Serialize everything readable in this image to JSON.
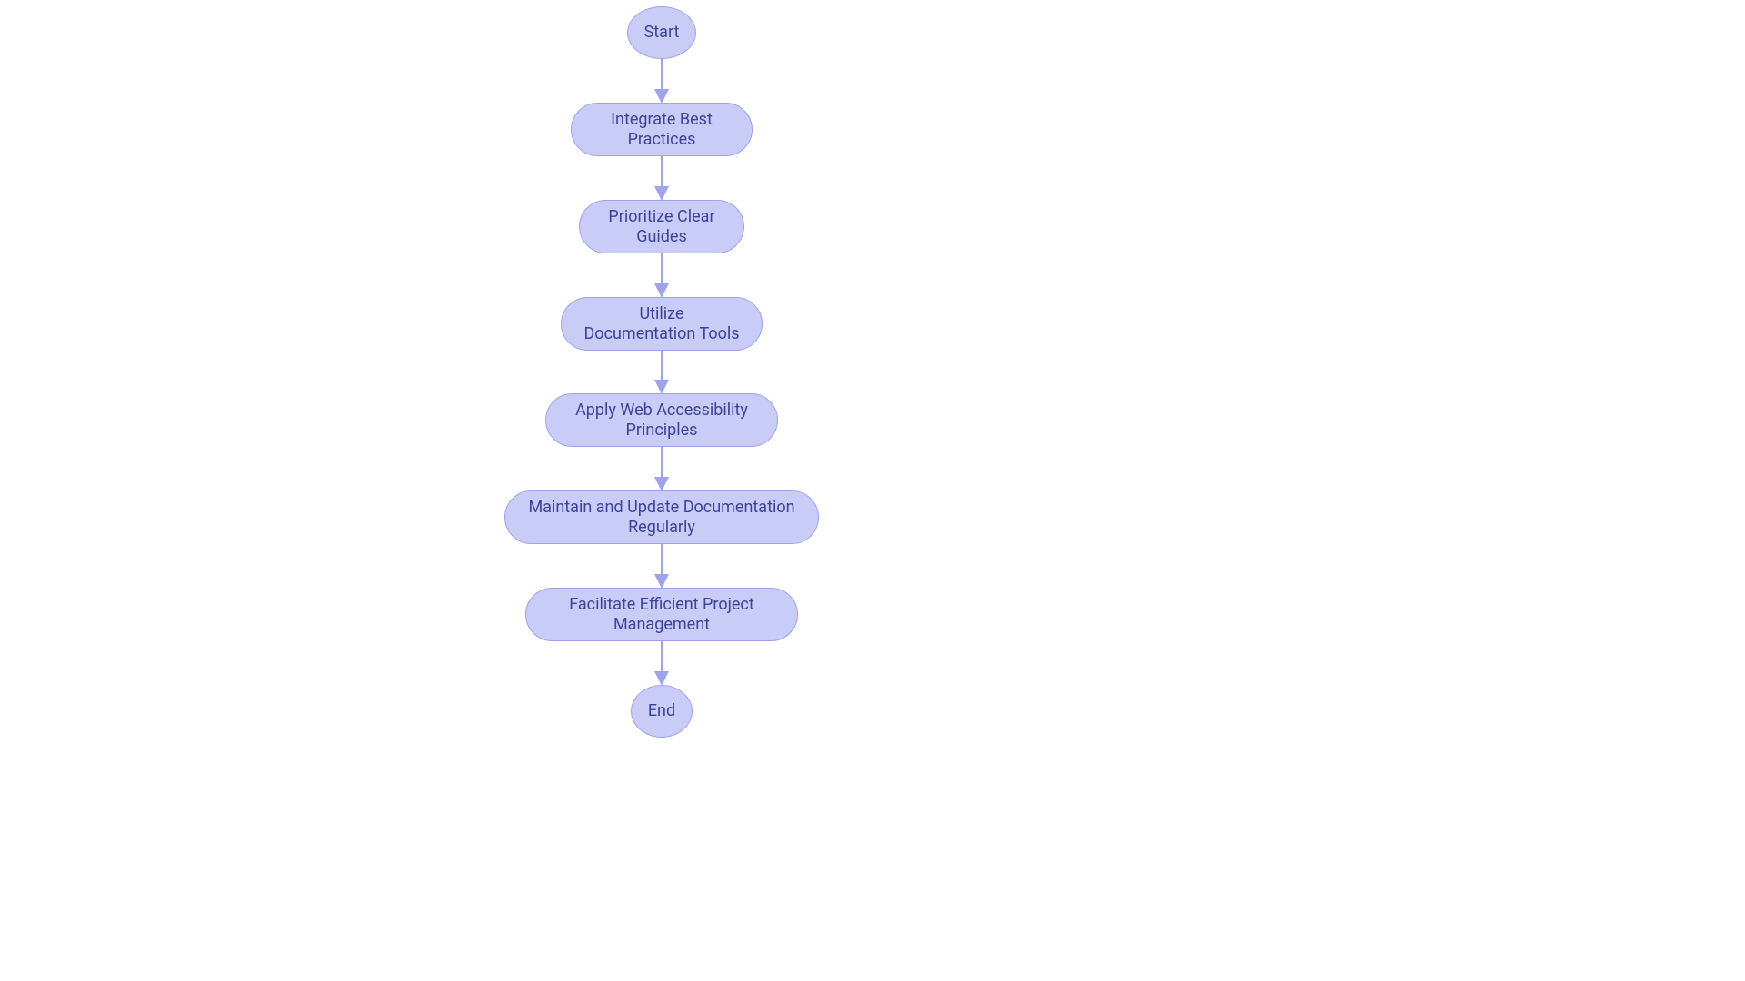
{
  "chart_data": {
    "type": "flowchart",
    "direction": "top-to-bottom",
    "nodes": [
      {
        "id": "start",
        "label": "Start",
        "shape": "circle"
      },
      {
        "id": "n1",
        "label": "Integrate Best Practices",
        "shape": "pill"
      },
      {
        "id": "n2",
        "label": "Prioritize Clear Guides",
        "shape": "pill"
      },
      {
        "id": "n3",
        "label": "Utilize Documentation Tools",
        "shape": "pill"
      },
      {
        "id": "n4",
        "label": "Apply Web Accessibility Principles",
        "shape": "pill"
      },
      {
        "id": "n5",
        "label": "Maintain and Update Documentation Regularly",
        "shape": "pill"
      },
      {
        "id": "n6",
        "label": "Facilitate Efficient Project Management",
        "shape": "pill"
      },
      {
        "id": "end",
        "label": "End",
        "shape": "circle"
      }
    ],
    "edges": [
      [
        "start",
        "n1"
      ],
      [
        "n1",
        "n2"
      ],
      [
        "n2",
        "n3"
      ],
      [
        "n3",
        "n4"
      ],
      [
        "n4",
        "n5"
      ],
      [
        "n5",
        "n6"
      ],
      [
        "n6",
        "end"
      ]
    ],
    "colors": {
      "fill": "#c9ccf7",
      "stroke": "#9ea3ec",
      "text": "#3c4399"
    }
  }
}
